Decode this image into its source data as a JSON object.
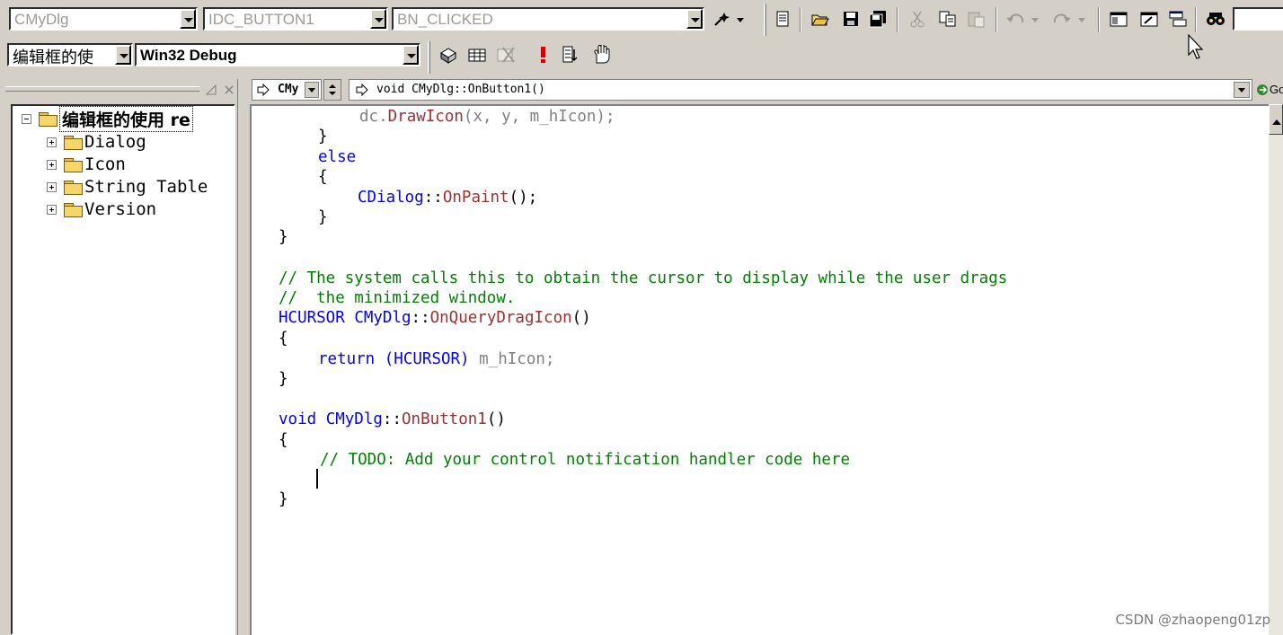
{
  "toolbar1": {
    "class_combo": "CMyDlg",
    "id_combo": "IDC_BUTTON1",
    "msg_combo": "BN_CLICKED"
  },
  "toolbar2": {
    "project_combo": "编辑框的使",
    "config_combo": "Win32 Debug"
  },
  "left_pane": {
    "root_label": "编辑框的使用 re",
    "items": [
      {
        "label": "Dialog"
      },
      {
        "label": "Icon"
      },
      {
        "label": "String Table"
      },
      {
        "label": "Version"
      }
    ]
  },
  "editor_header": {
    "class_label": "CMy",
    "function_label": "void CMyDlg::OnButton1()",
    "go_label": "Go"
  },
  "code": {
    "l1_obj": "dc",
    "l1_fn": "DrawIcon",
    "l1_args": "(x, y, m_hIcon);",
    "l2": "}",
    "l3": "else",
    "l4": "{",
    "l5_cls": "CDialog",
    "l5_fn": "OnPaint",
    "l5_rest": "();",
    "l6": "}",
    "l7": "}",
    "c1": "// The system calls this to obtain the cursor to display while the user drags",
    "c2": "//  the minimized window.",
    "f1_type": "HCURSOR",
    "f1_cls": "CMyDlg",
    "f1_fn": "OnQueryDragIcon",
    "f1_paren": "()",
    "f1_open": "{",
    "f1_ret": "return",
    "f1_cast": "(HCURSOR)",
    "f1_val": "m_hIcon;",
    "f1_close": "}",
    "f2_void": "void",
    "f2_cls": "CMyDlg",
    "f2_fn": "OnButton1",
    "f2_paren": "()",
    "f2_open": "{",
    "f2_todo": "// TODO: Add your control notification handler code here",
    "f2_close": "}"
  },
  "watermark": "CSDN @zhaopeng01zp"
}
